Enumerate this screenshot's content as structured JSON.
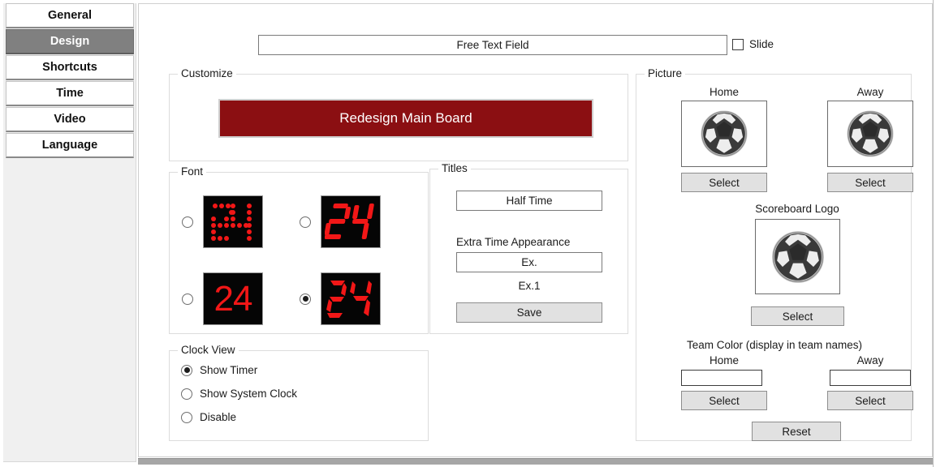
{
  "sidebar": {
    "tabs": [
      {
        "label": "General",
        "selected": false
      },
      {
        "label": "Design",
        "selected": true
      },
      {
        "label": "Shortcuts",
        "selected": false
      },
      {
        "label": "Time",
        "selected": false
      },
      {
        "label": "Video",
        "selected": false
      },
      {
        "label": "Language",
        "selected": false
      }
    ]
  },
  "topbar": {
    "free_text_value": "Free Text Field",
    "free_text_placeholder": "Free Text Field",
    "slide_label": "Slide",
    "slide_checked": false
  },
  "customize": {
    "title": "Customize",
    "redesign_label": "Redesign Main Board",
    "redesign_color": "#8B0F12"
  },
  "font": {
    "title": "Font",
    "options": [
      {
        "style": "dot-matrix",
        "value": "24",
        "selected": false
      },
      {
        "style": "seven-seg-italic",
        "value": "24",
        "selected": false
      },
      {
        "style": "plain-bold",
        "value": "24",
        "selected": false
      },
      {
        "style": "seven-seg-bold",
        "value": "24",
        "selected": true
      }
    ],
    "digit_color": "#F21717",
    "screen_color": "#050505"
  },
  "titles": {
    "title": "Titles",
    "half_time_value": "Half Time",
    "extra_time_label": "Extra Time Appearance",
    "extra_time_value": "Ex.",
    "extra_time_preview": "Ex.1",
    "save_label": "Save"
  },
  "clock_view": {
    "title": "Clock View",
    "options": [
      {
        "label": "Show Timer",
        "selected": true
      },
      {
        "label": "Show System Clock",
        "selected": false
      },
      {
        "label": "Disable",
        "selected": false
      }
    ]
  },
  "picture": {
    "title": "Picture",
    "home_label": "Home",
    "away_label": "Away",
    "home_select_label": "Select",
    "away_select_label": "Select",
    "logo_label": "Scoreboard Logo",
    "logo_select_label": "Select",
    "team_color_label": "Team Color (display in team names)",
    "team_color_home_label": "Home",
    "team_color_away_label": "Away",
    "team_color_home_value": "",
    "team_color_away_value": "",
    "home_color_select_label": "Select",
    "away_color_select_label": "Select",
    "reset_label": "Reset"
  }
}
